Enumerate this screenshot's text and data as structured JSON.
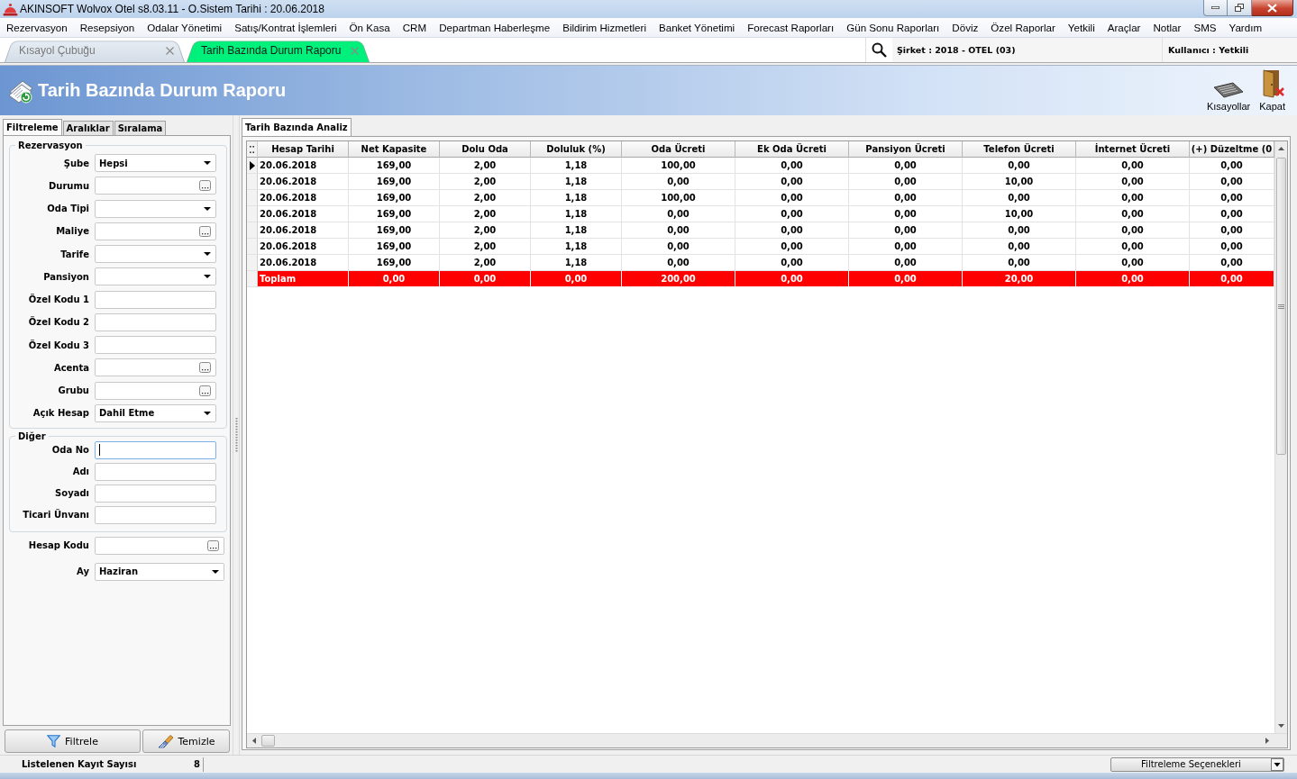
{
  "window": {
    "title": "AKINSOFT Wolvox Otel s8.03.11 - O.Sistem Tarihi : 20.06.2018"
  },
  "menu": [
    "Rezervasyon",
    "Resepsiyon",
    "Odalar Yönetimi",
    "Satış/Kontrat İşlemleri",
    "Ön Kasa",
    "CRM",
    "Departman Haberleşme",
    "Bildirim Hizmetleri",
    "Banket Yönetimi",
    "Forecast Raporları",
    "Gün Sonu Raporları",
    "Döviz",
    "Özel Raporlar",
    "Yetkili",
    "Araçlar",
    "Notlar",
    "SMS",
    "Yardım"
  ],
  "doc_tabs": [
    {
      "label": "Kısayol Çubuğu",
      "selected": false
    },
    {
      "label": "Tarih Bazında Durum Raporu",
      "selected": true
    }
  ],
  "info_bar": {
    "company": "Şirket : 2018 - OTEL (03)",
    "user": "Kullanıcı : Yetkili"
  },
  "header": {
    "title": "Tarih Bazında Durum Raporu",
    "tools": [
      {
        "label": "Kısayollar",
        "kind": "keyboard"
      },
      {
        "label": "Kapat",
        "kind": "door"
      }
    ]
  },
  "filter_panel": {
    "tabs": [
      {
        "label": "Filtreleme",
        "selected": true
      },
      {
        "label": "Aralıklar",
        "selected": false
      },
      {
        "label": "Sıralama",
        "selected": false
      }
    ],
    "groups": [
      {
        "title": "Rezervasyon",
        "fields": [
          {
            "label": "Şube",
            "kind": "dropdown",
            "value": "Hepsi",
            "focused": false
          },
          {
            "label": "Durumu",
            "kind": "lookup",
            "focused": false
          },
          {
            "label": "Oda Tipi",
            "kind": "dropdown",
            "focused": false
          },
          {
            "label": "Maliye",
            "kind": "lookup",
            "focused": false
          },
          {
            "label": "Tarife",
            "kind": "dropdown",
            "focused": false
          },
          {
            "label": "Pansiyon",
            "kind": "dropdown",
            "focused": false
          },
          {
            "label": "Özel Kodu 1",
            "kind": "text",
            "focused": false
          },
          {
            "label": "Özel Kodu 2",
            "kind": "text",
            "focused": false
          },
          {
            "label": "Özel Kodu 3",
            "kind": "text",
            "focused": false
          },
          {
            "label": "Acenta",
            "kind": "lookup",
            "focused": false
          },
          {
            "label": "Grubu",
            "kind": "lookup",
            "focused": false
          },
          {
            "label": "Açık Hesap",
            "kind": "dropdown",
            "value": "Dahil Etme",
            "focused": false
          }
        ]
      },
      {
        "title": "Diğer",
        "fields": [
          {
            "label": "Oda No",
            "kind": "text",
            "focused": true
          },
          {
            "label": "Adı",
            "kind": "text",
            "focused": false
          },
          {
            "label": "Soyadı",
            "kind": "text",
            "focused": false
          },
          {
            "label": "Ticari Ünvanı",
            "kind": "text",
            "focused": false
          }
        ]
      }
    ],
    "extra_fields": [
      {
        "label": "Hesap Kodu",
        "kind": "lookup",
        "focused": false
      },
      {
        "label": "Ay",
        "kind": "dropdown",
        "value": "Haziran",
        "focused": false
      }
    ],
    "buttons": [
      {
        "label": "Filtrele",
        "kind": "filter"
      },
      {
        "label": "Temizle",
        "kind": "clear"
      }
    ]
  },
  "report": {
    "tabs": [
      {
        "label": "Tarih Bazında Analiz",
        "selected": true
      }
    ],
    "table": {
      "columns": [
        "Hesap Tarihi",
        "Net Kapasite",
        "Dolu Oda",
        "Doluluk (%)",
        "Oda Ücreti",
        "Ek Oda Ücreti",
        "Pansiyon Ücreti",
        "Telefon Ücreti",
        "İnternet Ücreti",
        "(+) Düzeltme (0"
      ],
      "rows": [
        {
          "current": true,
          "cells": [
            "20.06.2018",
            "169,00",
            "2,00",
            "1,18",
            "100,00",
            "0,00",
            "0,00",
            "0,00",
            "0,00",
            "0,00"
          ]
        },
        {
          "current": false,
          "cells": [
            "20.06.2018",
            "169,00",
            "2,00",
            "1,18",
            "0,00",
            "0,00",
            "0,00",
            "10,00",
            "0,00",
            "0,00"
          ]
        },
        {
          "current": false,
          "cells": [
            "20.06.2018",
            "169,00",
            "2,00",
            "1,18",
            "100,00",
            "0,00",
            "0,00",
            "0,00",
            "0,00",
            "0,00"
          ]
        },
        {
          "current": false,
          "cells": [
            "20.06.2018",
            "169,00",
            "2,00",
            "1,18",
            "0,00",
            "0,00",
            "0,00",
            "10,00",
            "0,00",
            "0,00"
          ]
        },
        {
          "current": false,
          "cells": [
            "20.06.2018",
            "169,00",
            "2,00",
            "1,18",
            "0,00",
            "0,00",
            "0,00",
            "0,00",
            "0,00",
            "0,00"
          ]
        },
        {
          "current": false,
          "cells": [
            "20.06.2018",
            "169,00",
            "2,00",
            "1,18",
            "0,00",
            "0,00",
            "0,00",
            "0,00",
            "0,00",
            "0,00"
          ]
        },
        {
          "current": false,
          "cells": [
            "20.06.2018",
            "169,00",
            "2,00",
            "1,18",
            "0,00",
            "0,00",
            "0,00",
            "0,00",
            "0,00",
            "0,00"
          ]
        }
      ],
      "total": {
        "cells": [
          "Toplam",
          "0,00",
          "0,00",
          "0,00",
          "200,00",
          "0,00",
          "0,00",
          "20,00",
          "0,00",
          "0,00"
        ]
      }
    }
  },
  "status_bar": {
    "count_label": "Listelenen Kayıt Sayısı",
    "count": "8",
    "options_button": "Filtreleme Seçenekleri"
  }
}
